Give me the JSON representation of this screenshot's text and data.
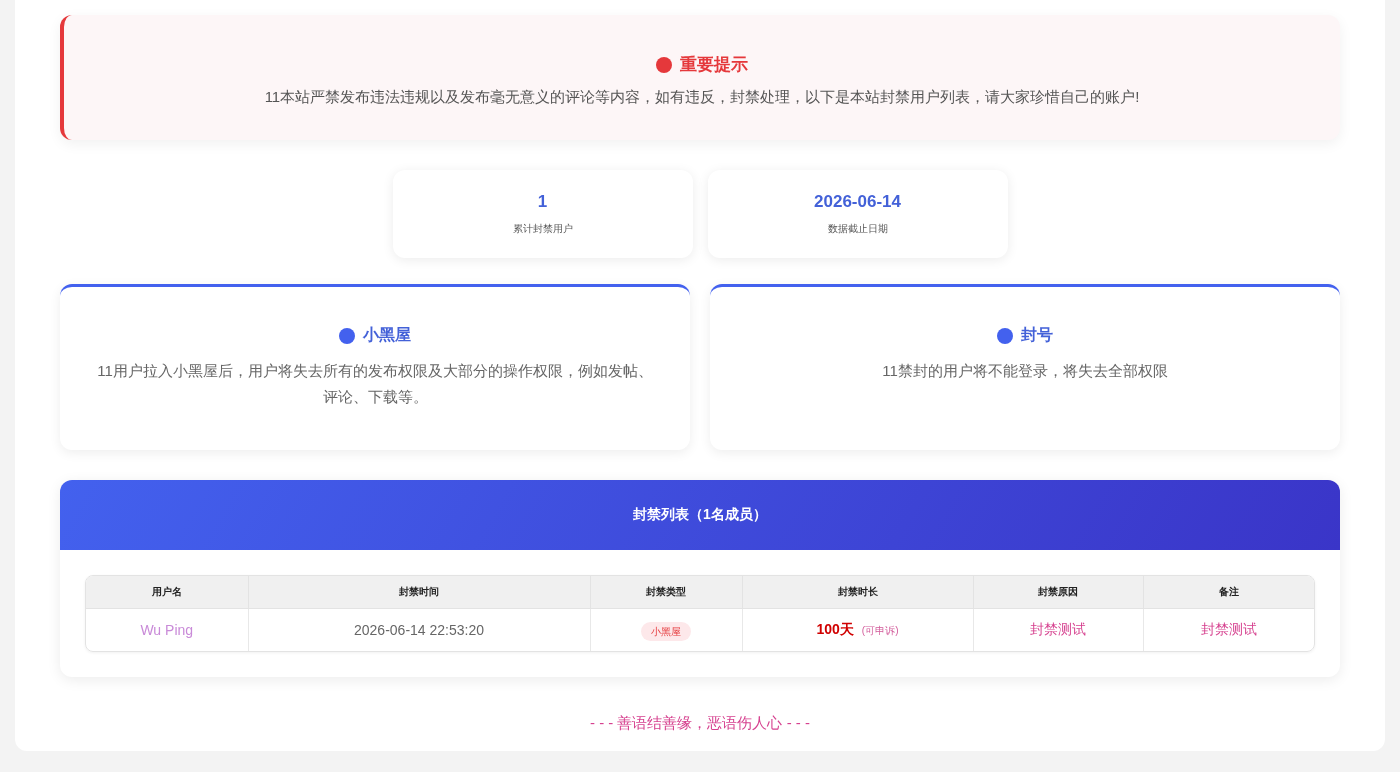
{
  "notice": {
    "title": "重要提示",
    "text": "11本站严禁发布违法违规以及发布毫无意义的评论等内容，如有违反，封禁处理，以下是本站封禁用户列表，请大家珍惜自己的账户!"
  },
  "stats": [
    {
      "value": "1",
      "label": "累计封禁用户"
    },
    {
      "value": "2026-06-14",
      "label": "数据截止日期"
    }
  ],
  "info_cards": [
    {
      "title": "小黑屋",
      "text": "11用户拉入小黑屋后，用户将失去所有的发布权限及大部分的操作权限，例如发帖、评论、下载等。"
    },
    {
      "title": "封号",
      "text": "11禁封的用户将不能登录，将失去全部权限"
    }
  ],
  "ban_list": {
    "title": "封禁列表（1名成员）",
    "columns": [
      "用户名",
      "封禁时间",
      "封禁类型",
      "封禁时长",
      "封禁原因",
      "备注"
    ],
    "rows": [
      {
        "username": "Wu Ping",
        "time": "2026-06-14 22:53:20",
        "type": "小黑屋",
        "duration": "100天",
        "duration_note": "(可申诉)",
        "reason": "封禁测试",
        "remark": "封禁测试"
      }
    ]
  },
  "footer": "- - - 善语结善缘，恶语伤人心 - - -"
}
